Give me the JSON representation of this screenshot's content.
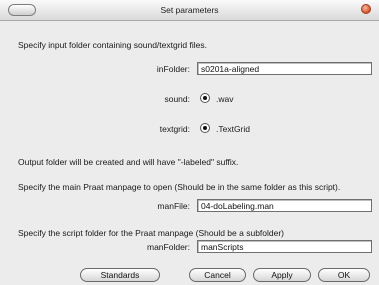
{
  "window": {
    "title": "Set parameters"
  },
  "form": {
    "input_folder_intro": "Specify input folder containing sound/textgrid files.",
    "in_folder_label": "inFolder:",
    "in_folder_value": "s0201a-aligned",
    "sound_label": "sound:",
    "sound_option": ".wav",
    "textgrid_label": "textgrid:",
    "textgrid_option": ".TextGrid",
    "output_note": "Output folder will be created and will have \"-labeled\" suffix.",
    "manpage_intro": "Specify the main Praat manpage to open (Should be in the same folder as this script).",
    "man_file_label": "manFile:",
    "man_file_value": "04-doLabeling.man",
    "script_folder_intro": "Specify the script folder for the Praat manpage (Should be a subfolder)",
    "man_folder_label": "manFolder:",
    "man_folder_value": "manScripts"
  },
  "buttons": {
    "standards": "Standards",
    "cancel": "Cancel",
    "apply": "Apply",
    "ok": "OK"
  }
}
